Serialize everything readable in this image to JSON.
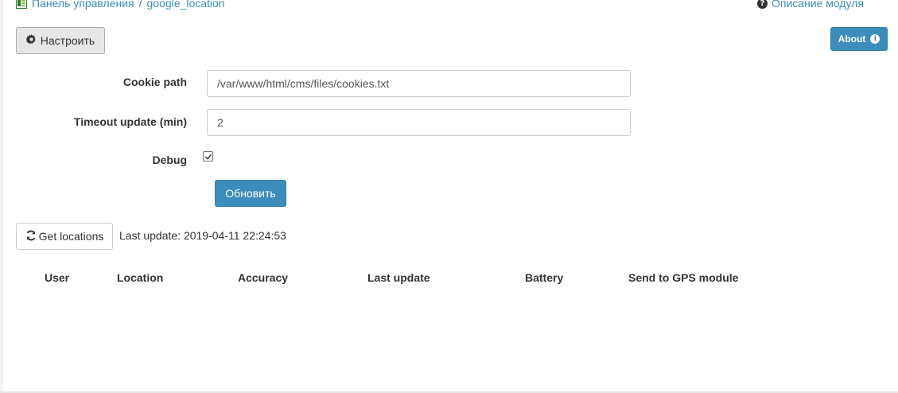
{
  "breadcrumb": {
    "items": [
      "Панель управления",
      "google_location"
    ],
    "separator": "/"
  },
  "header": {
    "module_help": "Описание модуля",
    "configure_label": "Настроить",
    "about_label": "About"
  },
  "form": {
    "cookie_path_label": "Cookie path",
    "cookie_path_value": "/var/www/html/cms/files/cookies.txt",
    "timeout_label": "Timeout update (min)",
    "timeout_value": "2",
    "debug_label": "Debug",
    "debug_checked": true,
    "submit_label": "Обновить"
  },
  "actions": {
    "get_locations_label": "Get locations",
    "last_update": "Last update: 2019-04-11 22:24:53"
  },
  "table": {
    "columns": [
      "User",
      "Location",
      "Accuracy",
      "Last update",
      "Battery",
      "Send to GPS module"
    ],
    "rows": []
  },
  "colors": {
    "accent": "#3c8dbc",
    "default_button": "#e6e6e6",
    "text": "#333333"
  },
  "icons": {
    "breadcrumb": "module-icon",
    "help": "question-circle-icon",
    "configure": "gear-icon",
    "about": "info-circle-icon",
    "get_locations": "refresh-icon",
    "debug": "checkbox-checked-icon"
  }
}
